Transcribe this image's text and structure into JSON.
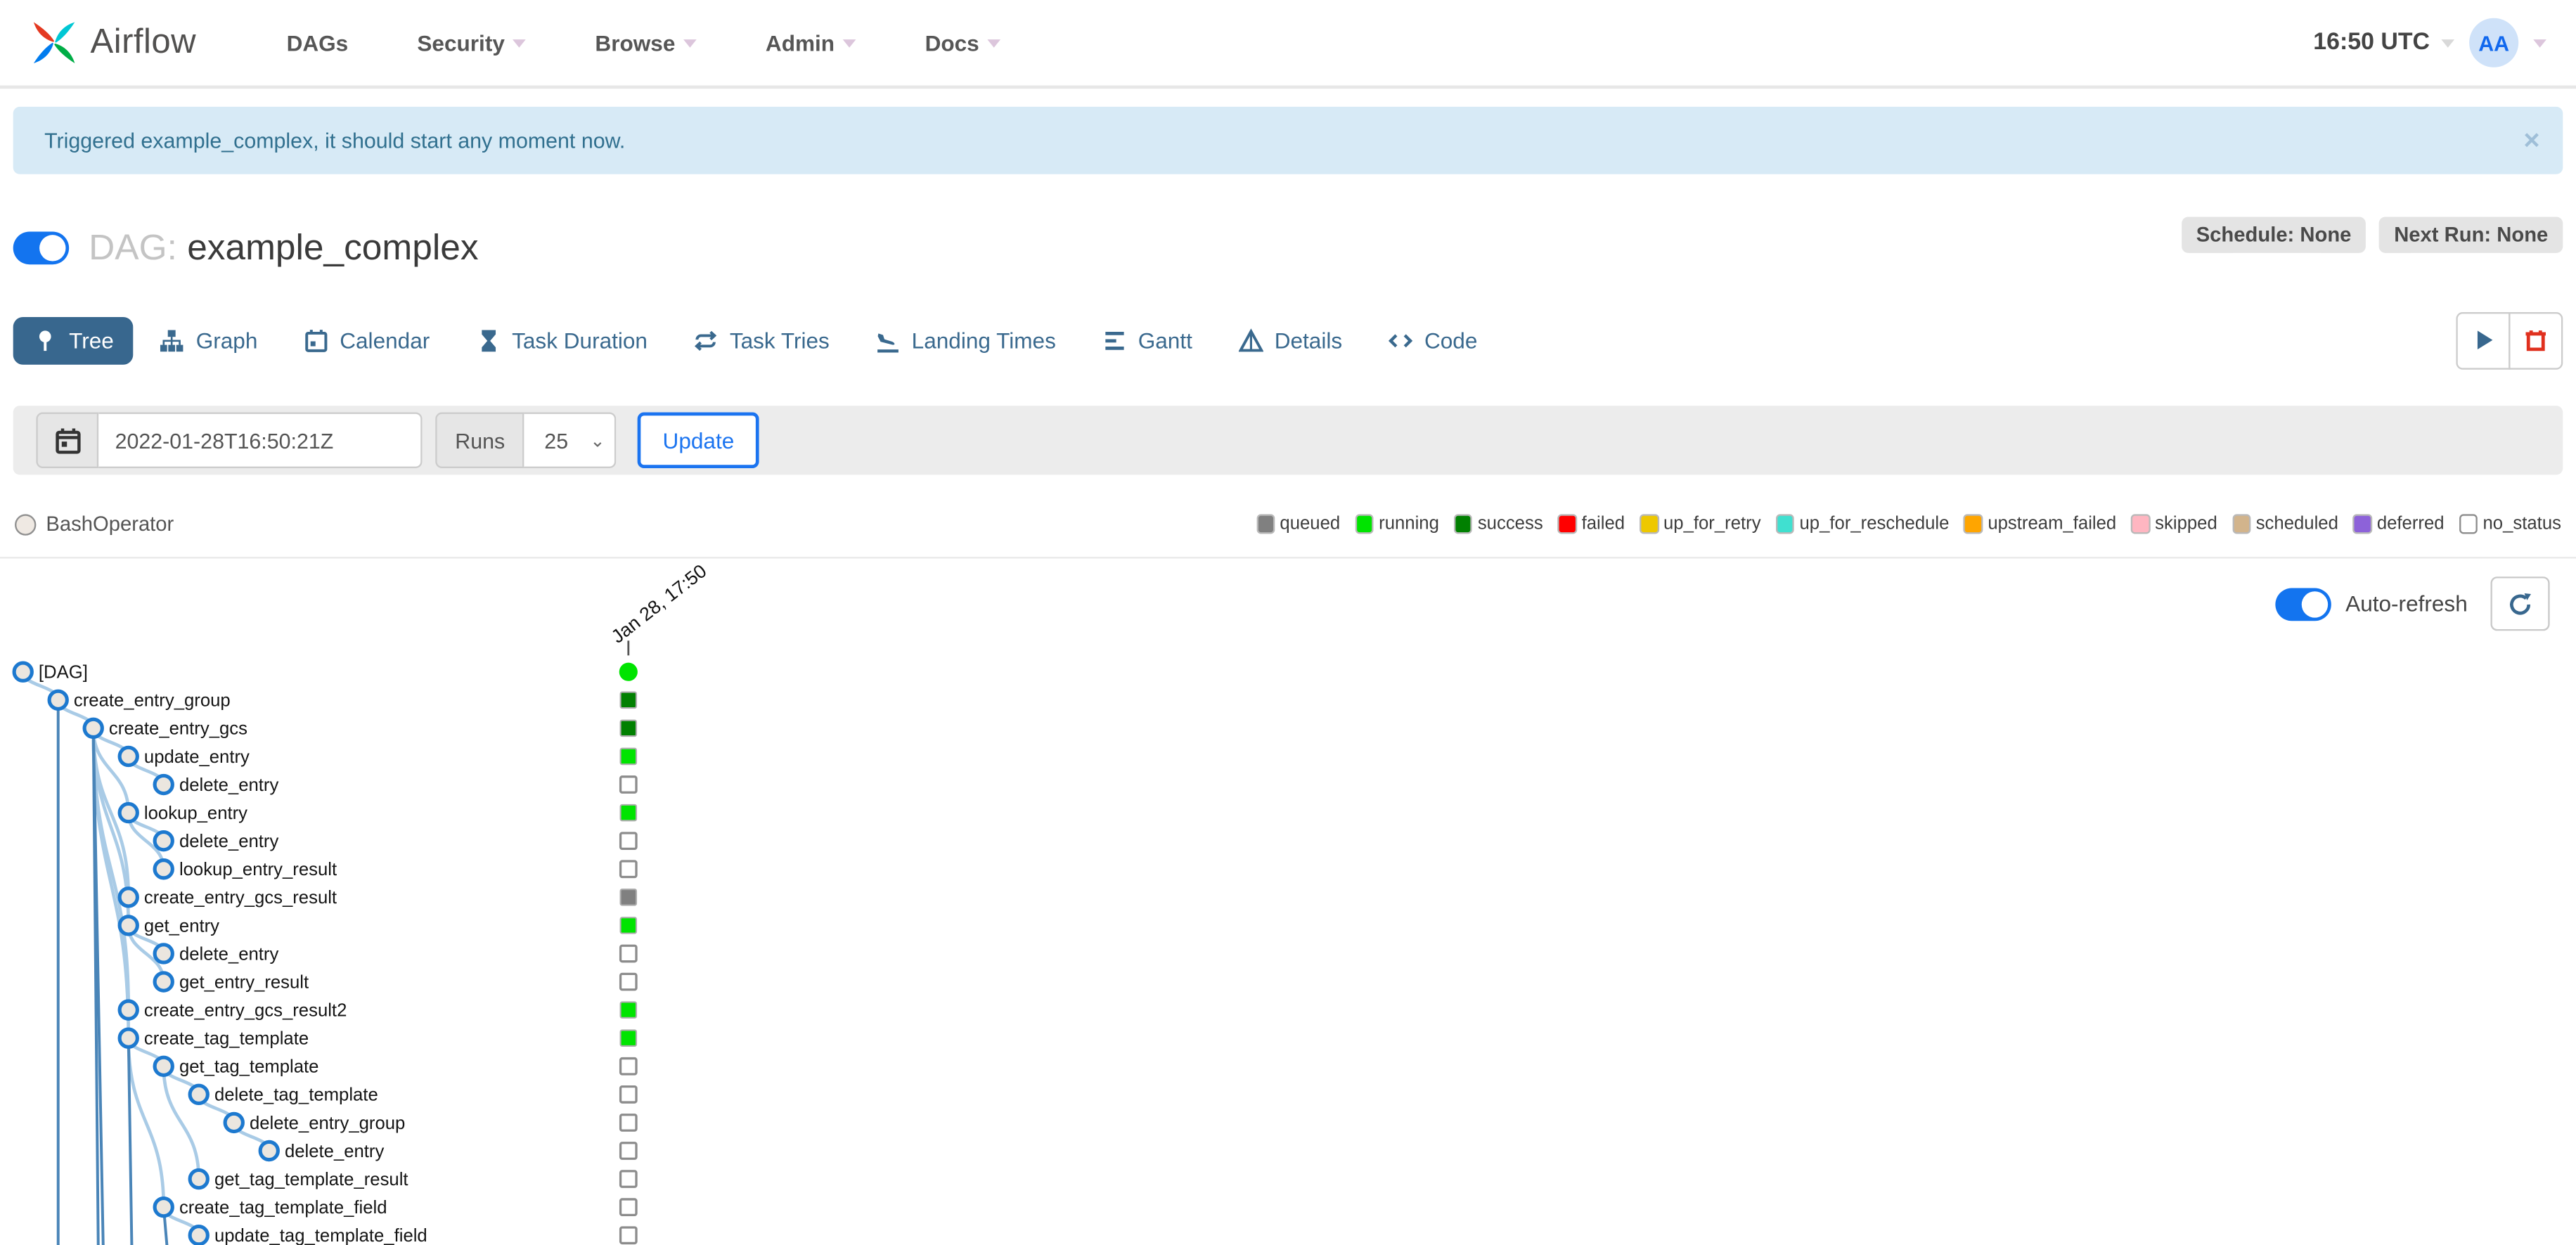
{
  "navbar": {
    "brand": "Airflow",
    "items": [
      {
        "label": "DAGs",
        "caret": false
      },
      {
        "label": "Security",
        "caret": true
      },
      {
        "label": "Browse",
        "caret": true
      },
      {
        "label": "Admin",
        "caret": true
      },
      {
        "label": "Docs",
        "caret": true
      }
    ],
    "clock": "16:50 UTC",
    "avatar": "AA"
  },
  "alert": {
    "message": "Triggered example_complex, it should start any moment now.",
    "close": "×"
  },
  "dag": {
    "label": "DAG:",
    "name": "example_complex",
    "schedule_badge": "Schedule: None",
    "next_run_badge": "Next Run: None"
  },
  "tabs": [
    {
      "label": "Tree",
      "icon": "tree-icon",
      "active": true
    },
    {
      "label": "Graph",
      "icon": "graph-icon",
      "active": false
    },
    {
      "label": "Calendar",
      "icon": "calendar-icon",
      "active": false
    },
    {
      "label": "Task Duration",
      "icon": "hourglass-icon",
      "active": false
    },
    {
      "label": "Task Tries",
      "icon": "retry-icon",
      "active": false
    },
    {
      "label": "Landing Times",
      "icon": "plane-landing-icon",
      "active": false
    },
    {
      "label": "Gantt",
      "icon": "gantt-icon",
      "active": false
    },
    {
      "label": "Details",
      "icon": "details-icon",
      "active": false
    },
    {
      "label": "Code",
      "icon": "code-icon",
      "active": false
    }
  ],
  "filter": {
    "date_value": "2022-01-28T16:50:21Z",
    "runs_label": "Runs",
    "runs_value": "25",
    "update_label": "Update"
  },
  "legend": {
    "operator": "BashOperator",
    "statuses": [
      {
        "label": "queued",
        "color": "#808080"
      },
      {
        "label": "running",
        "color": "#00e400"
      },
      {
        "label": "success",
        "color": "#018001"
      },
      {
        "label": "failed",
        "color": "#ff0000"
      },
      {
        "label": "up_for_retry",
        "color": "#eec800"
      },
      {
        "label": "up_for_reschedule",
        "color": "#40e0d0"
      },
      {
        "label": "upstream_failed",
        "color": "#ffa500"
      },
      {
        "label": "skipped",
        "color": "#ffb6c1"
      },
      {
        "label": "scheduled",
        "color": "#d2b48c"
      },
      {
        "label": "deferred",
        "color": "#8d62d9"
      },
      {
        "label": "no_status",
        "color": "#ffffff",
        "border": "#8c8c8c"
      }
    ]
  },
  "tree": {
    "auto_refresh": "Auto-refresh",
    "run_label": "Jan 28, 17:50",
    "tasks": [
      {
        "label": "[DAG]",
        "level": 0,
        "parent": -1,
        "status": "running",
        "marker": "circle"
      },
      {
        "label": "create_entry_group",
        "level": 1,
        "parent": 0,
        "status": "success",
        "marker": "square"
      },
      {
        "label": "create_entry_gcs",
        "level": 2,
        "parent": 1,
        "status": "success",
        "marker": "square"
      },
      {
        "label": "update_entry",
        "level": 3,
        "parent": 2,
        "status": "running",
        "marker": "square"
      },
      {
        "label": "delete_entry",
        "level": 4,
        "parent": 3,
        "status": "no_status",
        "marker": "square"
      },
      {
        "label": "lookup_entry",
        "level": 3,
        "parent": 2,
        "status": "running",
        "marker": "square"
      },
      {
        "label": "delete_entry",
        "level": 4,
        "parent": 5,
        "status": "no_status",
        "marker": "square"
      },
      {
        "label": "lookup_entry_result",
        "level": 4,
        "parent": 5,
        "status": "no_status",
        "marker": "square"
      },
      {
        "label": "create_entry_gcs_result",
        "level": 3,
        "parent": 2,
        "status": "queued",
        "marker": "square"
      },
      {
        "label": "get_entry",
        "level": 3,
        "parent": 2,
        "status": "running",
        "marker": "square"
      },
      {
        "label": "delete_entry",
        "level": 4,
        "parent": 9,
        "status": "no_status",
        "marker": "square"
      },
      {
        "label": "get_entry_result",
        "level": 4,
        "parent": 9,
        "status": "no_status",
        "marker": "square"
      },
      {
        "label": "create_entry_gcs_result2",
        "level": 3,
        "parent": 2,
        "status": "running",
        "marker": "square"
      },
      {
        "label": "create_tag_template",
        "level": 3,
        "parent": 2,
        "status": "running",
        "marker": "square"
      },
      {
        "label": "get_tag_template",
        "level": 4,
        "parent": 13,
        "status": "no_status",
        "marker": "square"
      },
      {
        "label": "delete_tag_template",
        "level": 5,
        "parent": 14,
        "status": "no_status",
        "marker": "square"
      },
      {
        "label": "delete_entry_group",
        "level": 6,
        "parent": 15,
        "status": "no_status",
        "marker": "square"
      },
      {
        "label": "delete_entry",
        "level": 7,
        "parent": 16,
        "status": "no_status",
        "marker": "square"
      },
      {
        "label": "get_tag_template_result",
        "level": 5,
        "parent": 14,
        "status": "no_status",
        "marker": "square"
      },
      {
        "label": "create_tag_template_field",
        "level": 4,
        "parent": 13,
        "status": "no_status",
        "marker": "square"
      },
      {
        "label": "update_tag_template_field",
        "level": 5,
        "parent": 19,
        "status": "no_status",
        "marker": "square"
      }
    ]
  }
}
